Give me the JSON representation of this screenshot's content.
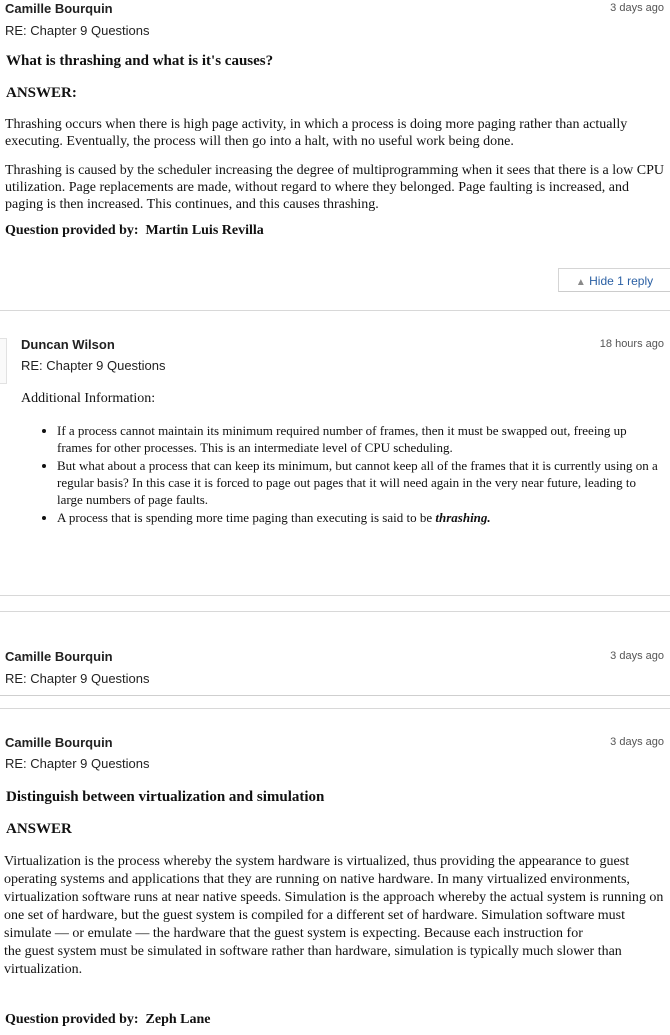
{
  "posts": [
    {
      "author": "Camille Bourquin",
      "time": "3 days ago",
      "subject": "RE: Chapter 9 Questions",
      "question": "What is thrashing and what is it's causes?",
      "answer_label": "ANSWER:",
      "paragraphs": [
        "Thrashing occurs when there is high page activity, in which a process is doing more paging rather than actually executing. Eventually, the process will then go into a halt, with no useful work being done.",
        "Thrashing is caused by the scheduler increasing the degree of multiprogramming when it sees that there is a low CPU utilization. Page replacements are made, without regard to where they belonged. Page faulting is increased, and paging is then increased. This continues, and this causes thrashing."
      ],
      "provided_label": "Question provided by:",
      "provided_name": "Martin Luis Revilla",
      "hide_reply": "Hide 1 reply"
    },
    {
      "author": "Duncan Wilson",
      "time": "18 hours ago",
      "subject": "RE: Chapter 9 Questions",
      "intro": "Additional Information:",
      "bullets": [
        "If a process cannot maintain its minimum required number of frames, then it must be swapped out, freeing up frames for other processes. This is an intermediate level of CPU scheduling.",
        "But what about a process that can keep its minimum, but cannot keep all of the frames that it is currently using on a regular basis? In this case it is forced to page out pages that it will need again in the very near future, leading to large numbers of page faults."
      ],
      "bullet3_text": "A process that is spending more time paging than executing is said to be ",
      "bullet3_em": "thrashing."
    },
    {
      "author": "Camille Bourquin",
      "time": "3 days ago",
      "subject": "RE: Chapter 9 Questions"
    },
    {
      "author": "Camille Bourquin",
      "time": "3 days ago",
      "subject": "RE: Chapter 9 Questions",
      "question": "Distinguish between virtualization and simulation",
      "answer_label": "ANSWER",
      "body_lines": [
        "Virtualization is the process whereby the system hardware is virtualized, thus providing the appearance to guest operating systems and applications that they are running on native hardware. In many virtualized environments, virtualization software runs at near native speeds. Simulation is the approach whereby the actual system is running on one set of hardware, but the guest system is compiled for a different set of hardware. Simulation software must simulate — or emulate — the hardware that the guest system is expecting. Because each instruction for",
        "the guest system must be simulated in software rather than hardware, simulation is typically much slower than virtualization."
      ],
      "provided_label": "Question provided by:",
      "provided_name": "Zeph Lane"
    }
  ]
}
